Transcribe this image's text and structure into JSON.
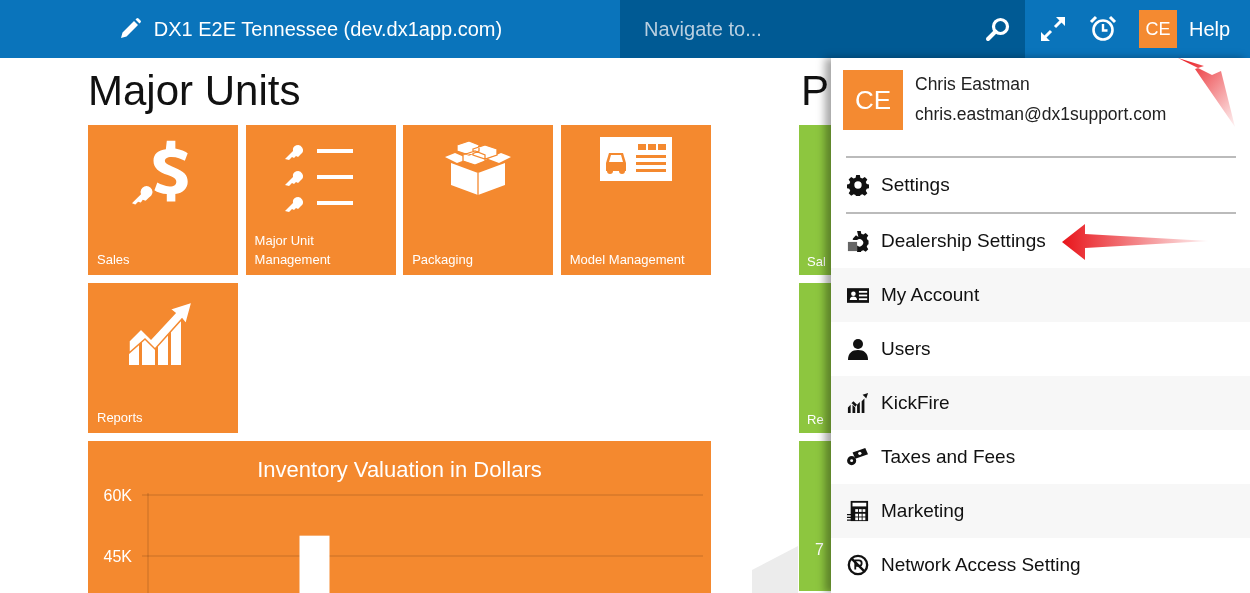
{
  "header": {
    "title": "DX1 E2E Tennessee (dev.dx1app.com)",
    "search": {
      "placeholder": "Navigate to..."
    },
    "avatar": "CE",
    "help": "Help"
  },
  "major_units": {
    "title": "Major Units",
    "tiles": [
      {
        "label": "Sales"
      },
      {
        "label": "Major Unit Management"
      },
      {
        "label": "Packaging"
      },
      {
        "label": "Model Management"
      },
      {
        "label": "Reports"
      }
    ],
    "chart": {
      "title": "Inventory Valuation in Dollars",
      "chart_data": {
        "type": "bar",
        "values": [
          null,
          50000,
          null,
          null,
          null
        ],
        "ylim": [
          0,
          60000
        ],
        "yticks": [
          {
            "value": 45000,
            "label": "45K"
          },
          {
            "value": 60000,
            "label": "60K"
          }
        ]
      }
    }
  },
  "second_section": {
    "title": "P",
    "tiles": [
      {
        "label": "Sal"
      },
      {
        "label": "Re"
      },
      {
        "label": "7"
      }
    ]
  },
  "user_menu": {
    "initials": "CE",
    "name": "Chris Eastman",
    "email": "chris.eastman@dx1support.com",
    "items": [
      {
        "label": "Settings"
      },
      {
        "label": "Dealership Settings"
      },
      {
        "label": "My Account"
      },
      {
        "label": "Users"
      },
      {
        "label": "KickFire"
      },
      {
        "label": "Taxes and Fees"
      },
      {
        "label": "Marketing"
      },
      {
        "label": "Network Access Setting"
      }
    ]
  }
}
